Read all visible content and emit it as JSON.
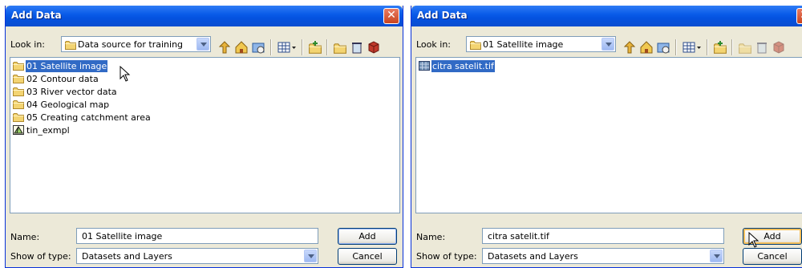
{
  "dialog_left": {
    "title": "Add Data",
    "look_in_label": "Look in:",
    "look_in_value": "Data source for training",
    "items": [
      {
        "label": "01 Satellite image",
        "icon": "folder-icon",
        "selected": true
      },
      {
        "label": "02 Contour data",
        "icon": "folder-icon",
        "selected": false
      },
      {
        "label": "03 River vector data",
        "icon": "folder-icon",
        "selected": false
      },
      {
        "label": "04 Geological map",
        "icon": "folder-icon",
        "selected": false
      },
      {
        "label": "05 Creating catchment area",
        "icon": "folder-icon",
        "selected": false
      },
      {
        "label": "tin_exmpl",
        "icon": "tin-dataset-icon",
        "selected": false
      }
    ],
    "name_label": "Name:",
    "name_value": "01 Satellite image",
    "type_label": "Show of type:",
    "type_value": "Datasets and Layers",
    "add_label": "Add",
    "cancel_label": "Cancel"
  },
  "dialog_right": {
    "title": "Add Data",
    "look_in_label": "Look in:",
    "look_in_value": "01 Satellite image",
    "items": [
      {
        "label": "citra satelit.tif",
        "icon": "raster-icon",
        "selected": true
      }
    ],
    "name_label": "Name:",
    "name_value": "citra satelit.tif",
    "type_label": "Show of type:",
    "type_value": "Datasets and Layers",
    "add_label": "Add",
    "cancel_label": "Cancel"
  },
  "colors": {
    "titlebar": "#0a5ce9",
    "dialog_bg": "#ece9d8",
    "selection": "#316ac5",
    "close_button": "#d8562e"
  }
}
